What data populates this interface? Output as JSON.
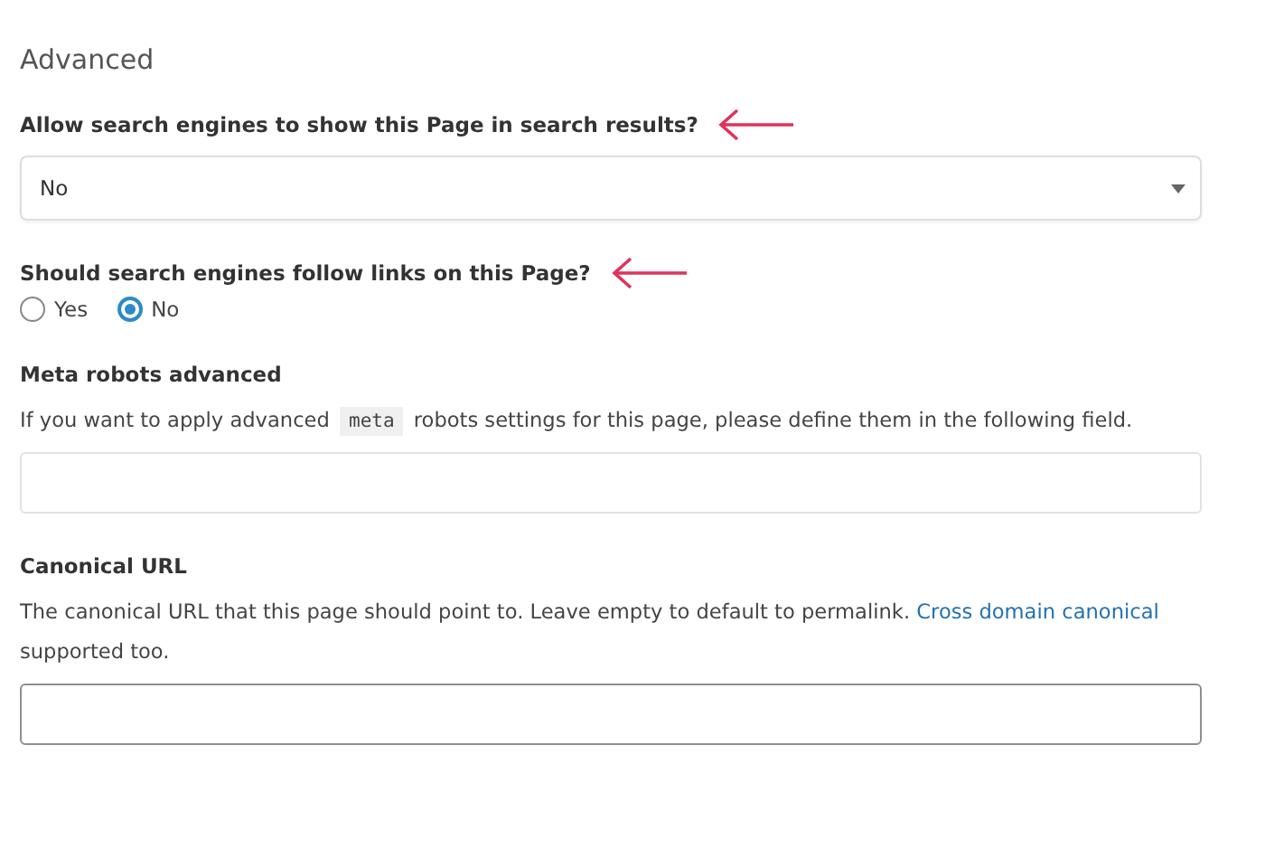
{
  "heading": "Advanced",
  "fields": [
    {
      "kind": "select",
      "label": "Allow search engines to show this Page in search results?",
      "arrow": true,
      "value": "No"
    },
    {
      "kind": "radio",
      "label": "Should search engines follow links on this Page?",
      "arrow": true,
      "options": [
        {
          "label": "Yes",
          "selected": false
        },
        {
          "label": "No",
          "selected": true
        }
      ]
    },
    {
      "kind": "text",
      "label": "Meta robots advanced",
      "arrow": false,
      "description": {
        "before": "If you want to apply advanced ",
        "code": "meta",
        "after": " robots settings for this page, please define them in the following field."
      }
    },
    {
      "kind": "text",
      "label": "Canonical URL",
      "arrow": false,
      "focused": true,
      "description": {
        "before": "The canonical URL that this page should point to. Leave empty to default to permalink. ",
        "link": "Cross domain canonical",
        "after": " supported too."
      }
    }
  ]
}
